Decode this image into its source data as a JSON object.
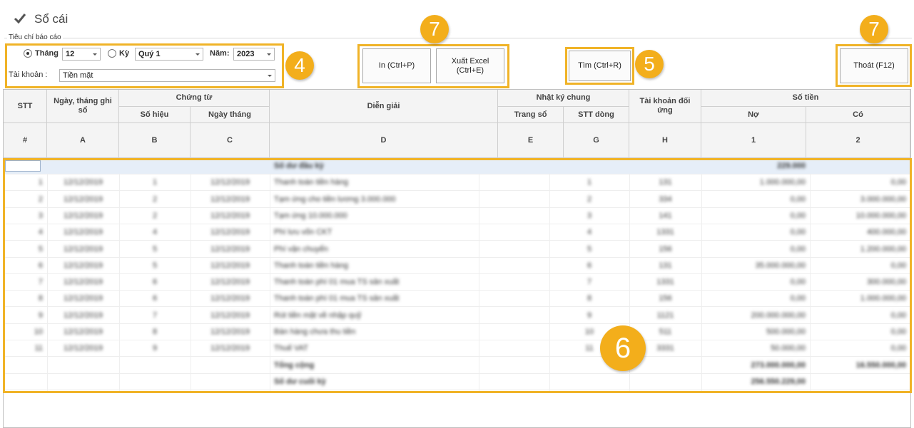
{
  "window": {
    "title": "Sổ cái"
  },
  "criteria": {
    "group_label": "Tiêu chí báo cáo",
    "month_label": "Tháng",
    "month_value": "12",
    "period_label": "Kỳ",
    "period_value": "Quý 1",
    "year_label": "Năm:",
    "year_value": "2023",
    "account_label": "Tài khoản :",
    "account_value": "Tiền mặt"
  },
  "buttons": {
    "print": "In  (Ctrl+P)",
    "export_line1": "Xuất Excel",
    "export_line2": "(Ctrl+E)",
    "find": "Tìm  (Ctrl+R)",
    "exit": "Thoát  (F12)"
  },
  "annotations": {
    "criteria": "4",
    "find": "5",
    "grid": "6",
    "actions": "7",
    "exit": "7"
  },
  "colors": {
    "highlight": "#f0b327",
    "badge": "#f3ae1b",
    "header_bg": "#f4f4f4"
  },
  "table": {
    "headers": {
      "stt": "STT",
      "date": "Ngày, tháng ghi sổ",
      "voucher": "Chứng từ",
      "voucher_no": "Số hiệu",
      "voucher_date": "Ngày tháng",
      "description": "Diễn giải",
      "journal": "Nhật ký chung",
      "page": "Trang sổ",
      "line": "STT dòng",
      "counter_account": "Tài khoản đối ứng",
      "amount": "Số tiền",
      "debit": "Nợ",
      "credit": "Có"
    },
    "codes": {
      "stt": "#",
      "date": "A",
      "voucher_no": "B",
      "voucher_date": "C",
      "description": "D",
      "page": "E",
      "line": "G",
      "counter_account": "H",
      "debit": "1",
      "credit": "2"
    },
    "rows": [
      {
        "stt": "",
        "date": "",
        "no": "",
        "vdate": "",
        "desc": "Số dư đầu kỳ",
        "page": "",
        "line": "",
        "acct": "",
        "debit": "229.000",
        "credit": "",
        "bold": true
      },
      {
        "stt": "1",
        "date": "12/12/2019",
        "no": "1",
        "vdate": "12/12/2019",
        "desc": "Thanh toán tiền hàng",
        "page": "",
        "line": "1",
        "acct": "131",
        "debit": "1.000.000,00",
        "credit": "0,00"
      },
      {
        "stt": "2",
        "date": "12/12/2019",
        "no": "2",
        "vdate": "12/12/2019",
        "desc": "Tạm ứng cho tiền lương 3.000.000",
        "page": "",
        "line": "2",
        "acct": "334",
        "debit": "0,00",
        "credit": "3.000.000,00"
      },
      {
        "stt": "3",
        "date": "12/12/2019",
        "no": "2",
        "vdate": "12/12/2019",
        "desc": "Tạm ứng 10.000.000",
        "page": "",
        "line": "3",
        "acct": "141",
        "debit": "0,00",
        "credit": "10.000.000,00"
      },
      {
        "stt": "4",
        "date": "12/12/2019",
        "no": "4",
        "vdate": "12/12/2019",
        "desc": "Phí lưu vốn CKT",
        "page": "",
        "line": "4",
        "acct": "1331",
        "debit": "0,00",
        "credit": "400.000,00"
      },
      {
        "stt": "5",
        "date": "12/12/2019",
        "no": "5",
        "vdate": "12/12/2019",
        "desc": "Phí vận chuyển",
        "page": "",
        "line": "5",
        "acct": "156",
        "debit": "0,00",
        "credit": "1.200.000,00"
      },
      {
        "stt": "6",
        "date": "12/12/2019",
        "no": "5",
        "vdate": "12/12/2019",
        "desc": "Thanh toán tiền hàng",
        "page": "",
        "line": "6",
        "acct": "131",
        "debit": "35.000.000,00",
        "credit": "0,00"
      },
      {
        "stt": "7",
        "date": "12/12/2019",
        "no": "6",
        "vdate": "12/12/2019",
        "desc": "Thanh toán phí 01 mua TS sản xuất",
        "page": "",
        "line": "7",
        "acct": "1331",
        "debit": "0,00",
        "credit": "300.000,00"
      },
      {
        "stt": "8",
        "date": "12/12/2019",
        "no": "6",
        "vdate": "12/12/2019",
        "desc": "Thanh toán phí 01 mua TS sản xuất",
        "page": "",
        "line": "8",
        "acct": "156",
        "debit": "0,00",
        "credit": "1.000.000,00"
      },
      {
        "stt": "9",
        "date": "12/12/2019",
        "no": "7",
        "vdate": "12/12/2019",
        "desc": "Rút tiền mặt về nhập quỹ",
        "page": "",
        "line": "9",
        "acct": "1121",
        "debit": "200.000.000,00",
        "credit": "0,00"
      },
      {
        "stt": "10",
        "date": "12/12/2019",
        "no": "8",
        "vdate": "12/12/2019",
        "desc": "Bán hàng chưa thu tiền",
        "page": "",
        "line": "10",
        "acct": "511",
        "debit": "500.000,00",
        "credit": "0,00"
      },
      {
        "stt": "11",
        "date": "12/12/2019",
        "no": "9",
        "vdate": "12/12/2019",
        "desc": "Thuế VAT",
        "page": "",
        "line": "11",
        "acct": "3331",
        "debit": "50.000,00",
        "credit": "0,00"
      },
      {
        "stt": "",
        "date": "",
        "no": "",
        "vdate": "",
        "desc": "Tổng cộng",
        "page": "",
        "line": "",
        "acct": "",
        "debit": "273.000.000,00",
        "credit": "16.550.000,00",
        "bold": true
      },
      {
        "stt": "",
        "date": "",
        "no": "",
        "vdate": "",
        "desc": "Số dư cuối kỳ",
        "page": "",
        "line": "",
        "acct": "",
        "debit": "256.550.229,00",
        "credit": "",
        "bold": true
      }
    ]
  }
}
